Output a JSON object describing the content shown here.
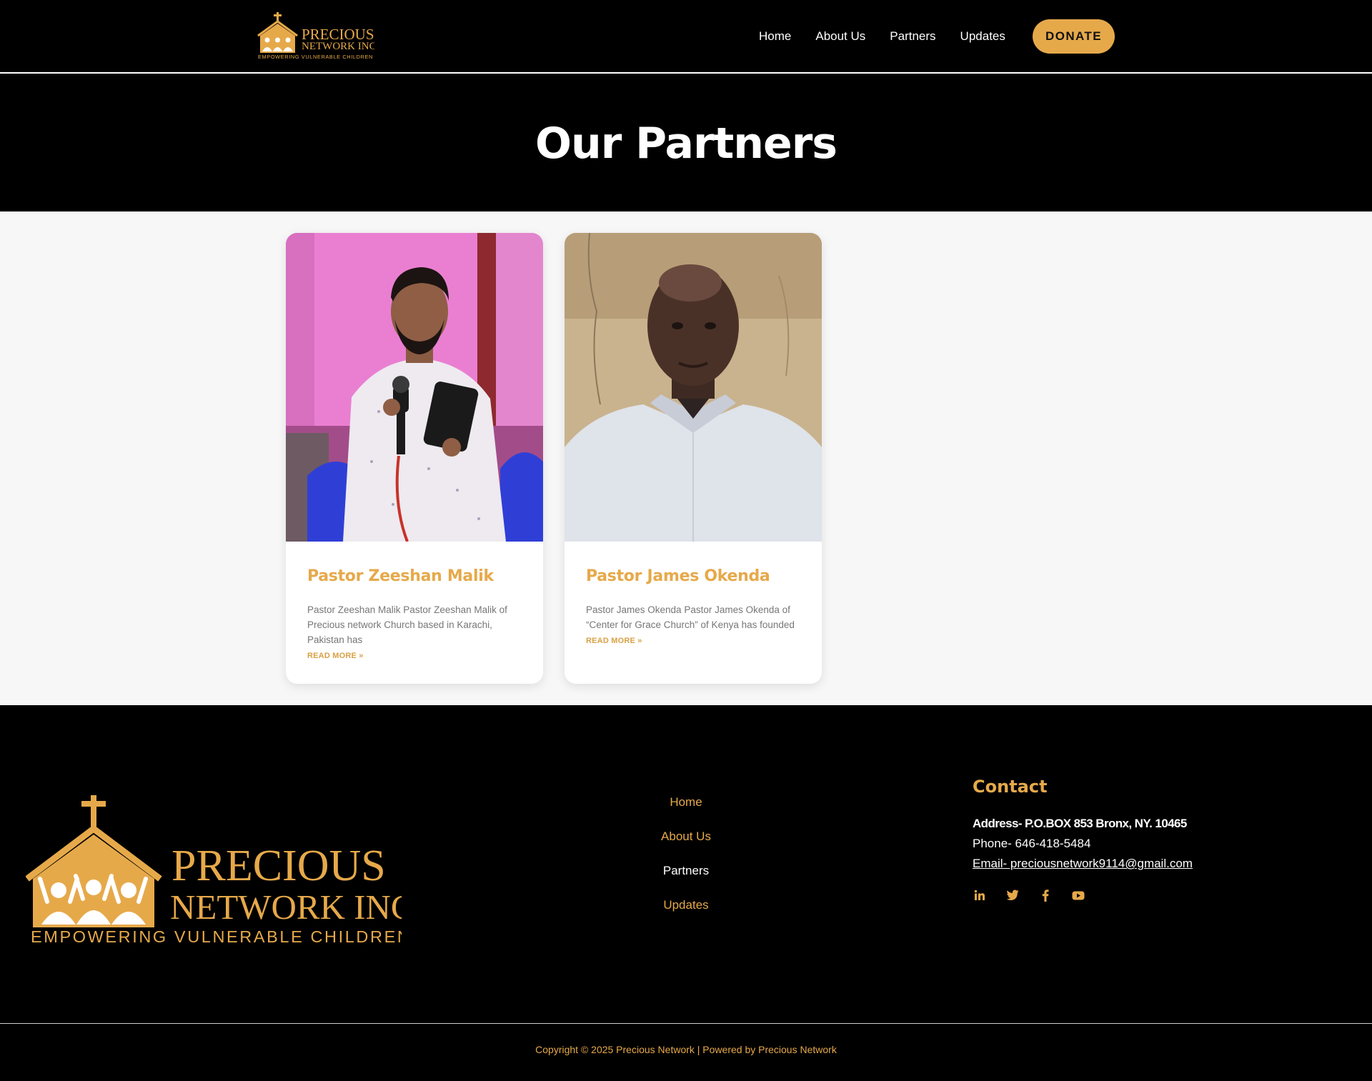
{
  "brand": {
    "logo_name": "PRECIOUS",
    "logo_sub": "NETWORK INC",
    "tagline": "EMPOWERING VULNERABLE CHILDREN",
    "accent_color": "#E6A94A"
  },
  "header": {
    "nav": [
      "Home",
      "About Us",
      "Partners",
      "Updates"
    ],
    "donate_label": "DONATE"
  },
  "hero": {
    "title": "Our Partners"
  },
  "partners": [
    {
      "name": "Pastor Zeeshan Malik",
      "excerpt": "Pastor Zeeshan Malik Pastor Zeeshan Malik of Precious network Church based in Karachi, Pakistan has",
      "read_more": "READ MORE »"
    },
    {
      "name": "Pastor James Okenda",
      "excerpt": "Pastor James Okenda Pastor James Okenda of “Center for Grace Church” of Kenya has founded",
      "read_more": "READ MORE »"
    }
  ],
  "footer": {
    "nav": [
      "Home",
      "About Us",
      "Partners",
      "Updates"
    ],
    "active_nav": "Partners",
    "contact": {
      "title": "Contact",
      "address": "Address- P.O.BOX 853 Bronx, NY. 10465",
      "phone": "Phone- 646-418-5484",
      "email": "Email- preciousnetwork9114@gmail.com"
    },
    "socials": [
      "linkedin-icon",
      "twitter-icon",
      "facebook-icon",
      "youtube-icon"
    ],
    "copyright": "Copyright © 2025 Precious Network | Powered by Precious Network"
  }
}
